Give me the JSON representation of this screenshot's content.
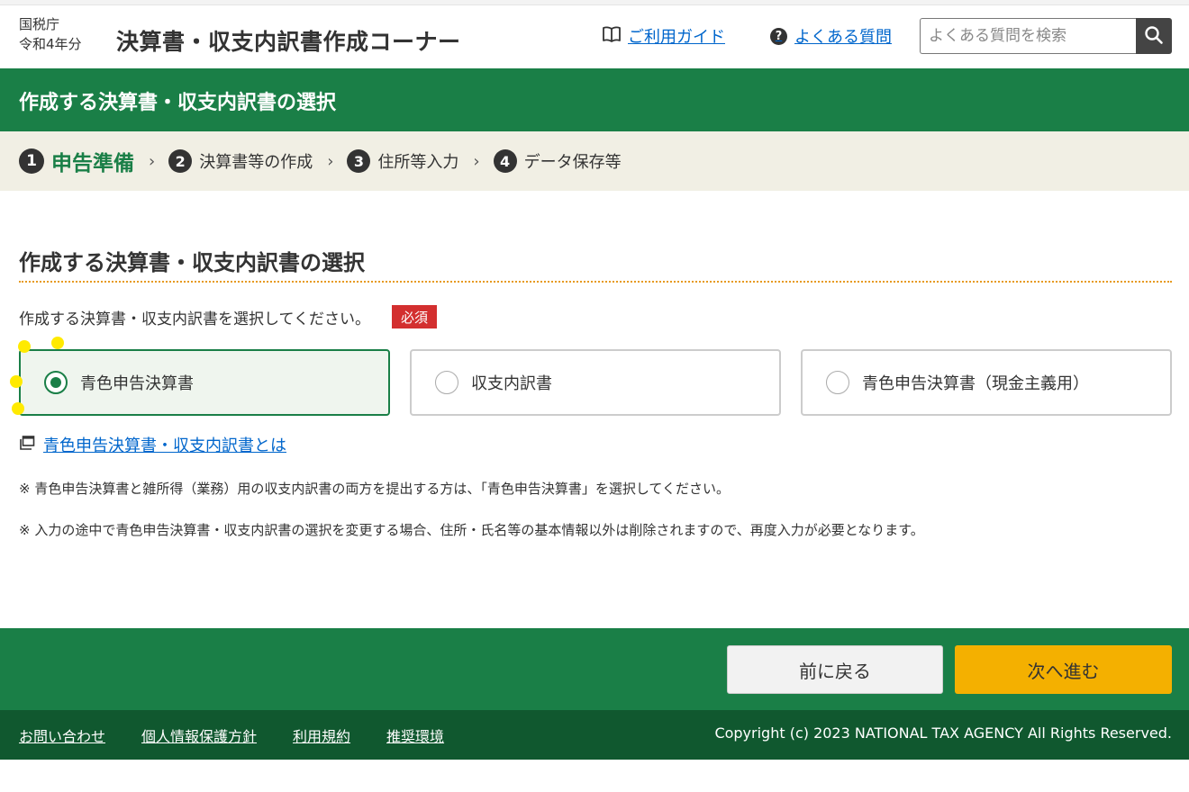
{
  "header": {
    "agency_line1": "国税庁",
    "agency_line2": "令和4年分",
    "site_title": "決算書・収支内訳書作成コーナー",
    "guide_link": "ご利用ガイド",
    "faq_link": "よくある質問",
    "faq_icon_glyph": "?",
    "search_placeholder": "よくある質問を検索"
  },
  "banner": {
    "title": "作成する決算書・収支内訳書の選択"
  },
  "steps": [
    {
      "num": "1",
      "label": "申告準備",
      "current": true
    },
    {
      "num": "2",
      "label": "決算書等の作成",
      "current": false
    },
    {
      "num": "3",
      "label": "住所等入力",
      "current": false
    },
    {
      "num": "4",
      "label": "データ保存等",
      "current": false
    }
  ],
  "step_separator": "›",
  "main": {
    "section_title": "作成する決算書・収支内訳書の選択",
    "instruction": "作成する決算書・収支内訳書を選択してください。",
    "required_badge": "必須",
    "options": [
      {
        "label": "青色申告決算書",
        "selected": true
      },
      {
        "label": "収支内訳書",
        "selected": false
      },
      {
        "label": "青色申告決算書（現金主義用）",
        "selected": false
      }
    ],
    "about_link": "青色申告決算書・収支内訳書とは",
    "notes": [
      "※ 青色申告決算書と雑所得（業務）用の収支内訳書の両方を提出する方は、「青色申告決算書」を選択してください。",
      "※ 入力の途中で青色申告決算書・収支内訳書の選択を変更する場合、住所・氏名等の基本情報以外は削除されますので、再度入力が必要となります。"
    ]
  },
  "actions": {
    "back": "前に戻る",
    "next": "次へ進む"
  },
  "footer": {
    "links": [
      "お問い合わせ",
      "個人情報保護方針",
      "利用規約",
      "推奨環境"
    ],
    "copyright": "Copyright (c) 2023 NATIONAL TAX AGENCY All Rights Reserved."
  },
  "colors": {
    "brand_green": "#1a7f47",
    "footer_green": "#10582f",
    "step_bar_bg": "#f1efe4",
    "accent_orange": "#e69a1e",
    "required_red": "#d32f2f",
    "next_button": "#f4b000",
    "link_blue": "#0066cc",
    "annotation_marker": "#ffea00"
  },
  "icons": {
    "guide": "open-book-icon",
    "faq": "question-circle-icon",
    "search": "magnifier-icon",
    "about_link": "new-window-icon",
    "step_separator": "chevron-right-icon"
  }
}
